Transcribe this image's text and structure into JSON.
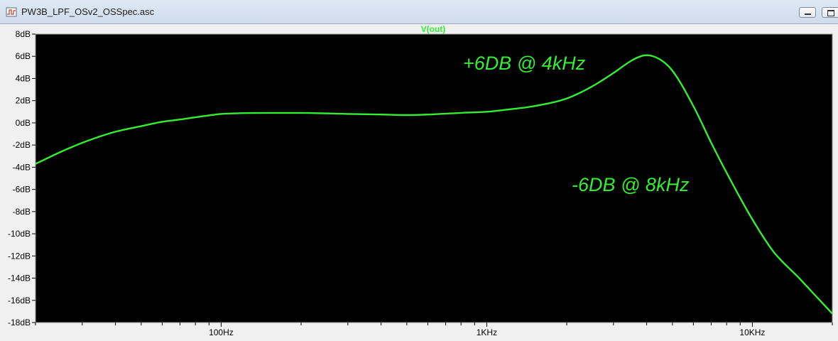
{
  "window": {
    "title": "PW3B_LPF_OSv2_OSSpec.asc",
    "icon": "schematic-icon"
  },
  "colors": {
    "plot_background": "#000000",
    "trace": "#33ee33",
    "annotation": "#33ee33",
    "frame_background": "#f0f0f0"
  },
  "chart_data": {
    "type": "line",
    "title": "V(out)",
    "xlabel": "",
    "ylabel": "",
    "x_scale": "log",
    "xlim": [
      20,
      20000
    ],
    "ylim": [
      -18,
      8
    ],
    "y_ticks": [
      8,
      6,
      4,
      2,
      0,
      -2,
      -4,
      -6,
      -8,
      -10,
      -12,
      -14,
      -16,
      -18
    ],
    "y_tick_labels": [
      "8dB",
      "6dB",
      "4dB",
      "2dB",
      "0dB",
      "-2dB",
      "-4dB",
      "-6dB",
      "-8dB",
      "-10dB",
      "-12dB",
      "-14dB",
      "-16dB",
      "-18dB"
    ],
    "x_ticks": [
      100,
      1000,
      10000
    ],
    "x_tick_labels": [
      "100Hz",
      "1KHz",
      "10KHz"
    ],
    "grid": false,
    "series": [
      {
        "name": "V(out)",
        "x": [
          20,
          25,
          30,
          40,
          50,
          60,
          70,
          80,
          100,
          150,
          200,
          300,
          400,
          500,
          600,
          800,
          1000,
          1200,
          1500,
          2000,
          2500,
          3000,
          3500,
          3800,
          4000,
          4500,
          5000,
          6000,
          7000,
          8000,
          10000,
          12000,
          15000,
          20000
        ],
        "y": [
          -3.7,
          -2.6,
          -1.8,
          -0.8,
          -0.3,
          0.1,
          0.3,
          0.5,
          0.8,
          0.9,
          0.9,
          0.8,
          0.75,
          0.7,
          0.75,
          0.9,
          1.0,
          1.2,
          1.5,
          2.2,
          3.3,
          4.5,
          5.6,
          6.0,
          6.1,
          5.7,
          4.7,
          1.5,
          -1.8,
          -4.5,
          -8.7,
          -11.6,
          -14.0,
          -17.2
        ]
      }
    ],
    "annotations": [
      {
        "text": "+6DB @ 4kHz"
      },
      {
        "text": "-6DB @ 8kHz"
      }
    ]
  }
}
